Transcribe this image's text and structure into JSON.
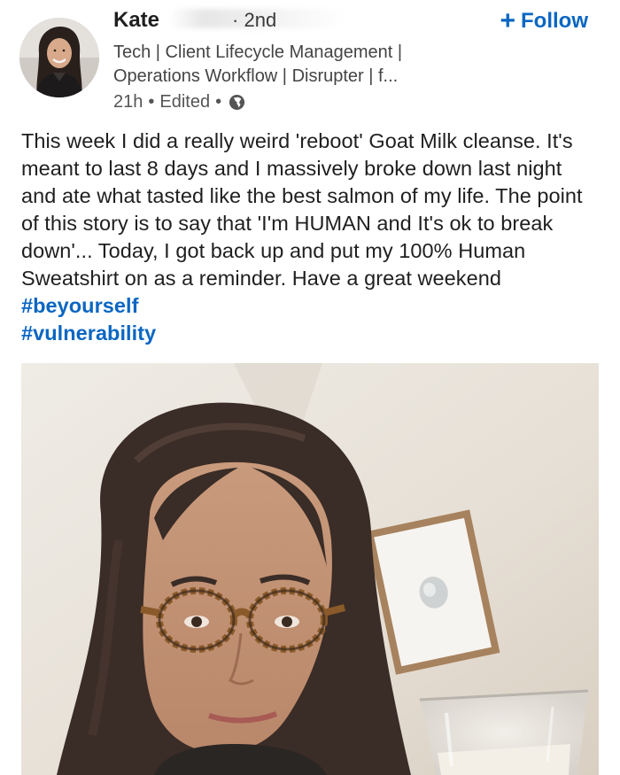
{
  "author": {
    "name": "Kate",
    "degree": "2nd",
    "headline": "Tech | Client Lifecycle Management | Operations Workflow | Disrupter | f...",
    "time": "21h",
    "edited": "Edited",
    "visibility_icon": "globe-icon"
  },
  "actions": {
    "follow_label": "Follow",
    "follow_icon": "plus-icon"
  },
  "post": {
    "text": "This week I did a really weird 'reboot' Goat Milk cleanse. It's meant to last 8 days and I massively broke down last night and ate what tasted like the best salmon of my life. The point of this story is to say that 'I'm HUMAN and It's ok to break down'... Today, I got back up and put my 100% Human Sweatshirt on as a reminder.  Have a great weekend ",
    "hashtags": [
      "#beyourself",
      "#vulnerability"
    ]
  },
  "colors": {
    "link": "#0a66c2",
    "text": "#1f1f1f",
    "muted": "#555555"
  }
}
